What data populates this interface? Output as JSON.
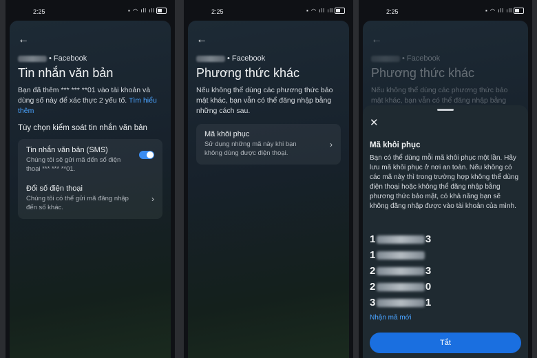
{
  "status_bar": {
    "time": "2:25",
    "icons_text": "▪ ◠ ıll ıll"
  },
  "screen1": {
    "account_service": "• Facebook",
    "title": "Tin nhắn văn bản",
    "description": "Bạn đã thêm *** *** **01 vào tài khoản và dùng số này để xác thực 2 yếu tố.",
    "learn_more": "Tìm hiểu thêm",
    "section_title": "Tùy chọn kiểm soát tin nhắn văn bản",
    "items": [
      {
        "title": "Tin nhắn văn bản (SMS)",
        "subtitle": "Chúng tôi sẽ gửi mã đến số điện thoại *** *** **01."
      },
      {
        "title": "Đổi số điện thoại",
        "subtitle": "Chúng tôi có thể gửi mã đăng nhập đến số khác."
      }
    ]
  },
  "screen2": {
    "account_service": "• Facebook",
    "title": "Phương thức khác",
    "description": "Nếu không thể dùng các phương thức bảo mật khác, bạn vẫn có thể đăng nhập bằng những cách sau.",
    "items": [
      {
        "title": "Mã khôi phục",
        "subtitle": "Sử dụng những mã này khi bạn không dùng được điện thoại."
      }
    ]
  },
  "screen3": {
    "account_service": "• Facebook",
    "title": "Phương thức khác",
    "description": "Nếu không thể dùng các phương thức bảo mật khác, bạn vẫn có thể đăng nhập bằng",
    "sheet": {
      "title": "Mã khôi phục",
      "description": "Bạn có thể dùng mỗi mã khôi phục một lần. Hãy lưu mã khôi phục ở nơi an toàn. Nếu không có các mã này thì trong trường hợp không thể dùng điện thoại hoặc không thể đăng nhập bằng phương thức bảo mật, có khả năng bạn sẽ không đăng nhập được vào tài khoản của mình.",
      "codes": [
        {
          "start": "1",
          "end": "3"
        },
        {
          "start": "1",
          "end": ""
        },
        {
          "start": "2",
          "end": "3"
        },
        {
          "start": "2",
          "end": "0"
        },
        {
          "start": "3",
          "end": "1"
        }
      ],
      "new_codes_link": "Nhận mã mới",
      "close_button": "Tắt"
    }
  },
  "colors": {
    "accent": "#1a6fe0",
    "link": "#4aa3ff",
    "toggle_on": "#3b8cf0"
  }
}
